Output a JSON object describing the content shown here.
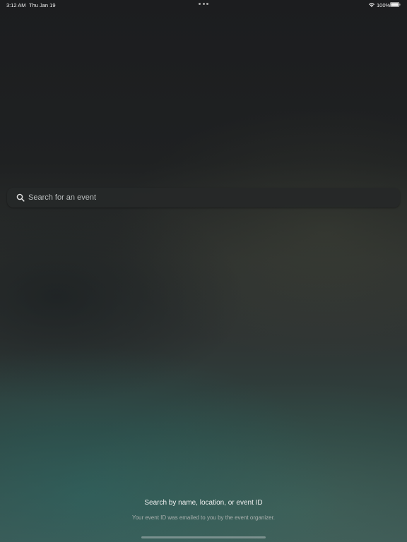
{
  "status_bar": {
    "time": "3:12 AM",
    "date": "Thu Jan 19",
    "battery_percent": "100%",
    "battery_level": 1.0,
    "icons": [
      "multitasking-dots-icon",
      "wifi-icon",
      "battery-icon"
    ]
  },
  "search": {
    "placeholder": "Search for an event",
    "value": "",
    "icon": "search-icon"
  },
  "hint": {
    "title": "Search by name, location, or event ID",
    "subtitle": "Your event ID was emailed to you by the event organizer."
  },
  "colors": {
    "text_primary": "#f0f0f0",
    "text_secondary": "#aab0ae",
    "search_background": "#262828"
  }
}
